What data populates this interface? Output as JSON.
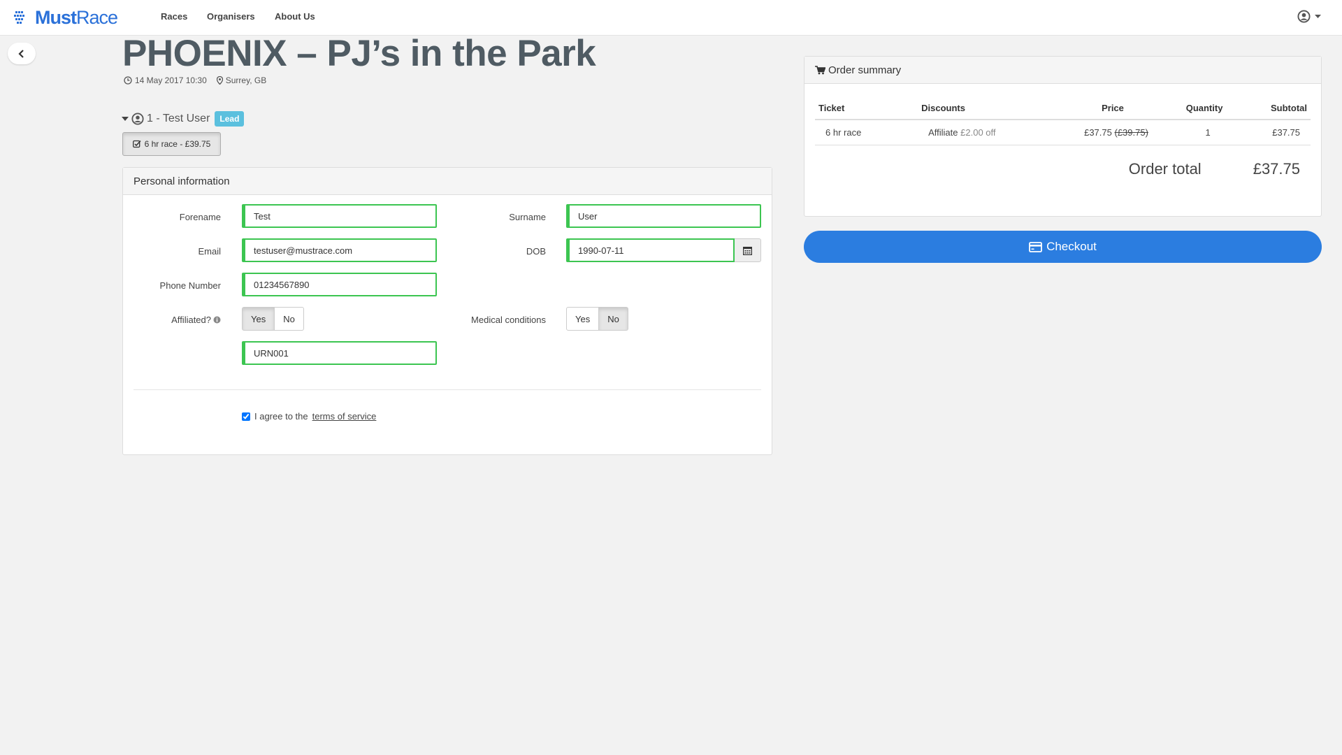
{
  "nav": {
    "logo_bold": "Must",
    "logo_light": "Race",
    "links": [
      "Races",
      "Organisers",
      "About Us"
    ]
  },
  "event": {
    "title": "PHOENIX – PJ’s in the Park",
    "datetime": "14 May 2017 10:30",
    "location": "Surrey, GB"
  },
  "entrant": {
    "label": "1 - Test User",
    "badge": "Lead",
    "ticket_button": "6 hr race - £39.75"
  },
  "personal": {
    "heading": "Personal information",
    "forename_label": "Forename",
    "forename_value": "Test",
    "surname_label": "Surname",
    "surname_value": "User",
    "email_label": "Email",
    "email_value": "testuser@mustrace.com",
    "dob_label": "DOB",
    "dob_value": "1990-07-11",
    "phone_label": "Phone Number",
    "phone_value": "01234567890",
    "affiliated_label": "Affiliated?",
    "affiliated_yes": "Yes",
    "affiliated_no": "No",
    "affiliated_selected": "Yes",
    "urn_value": "URN001",
    "medical_label": "Medical conditions",
    "medical_yes": "Yes",
    "medical_no": "No",
    "medical_selected": "No",
    "agree_text": "I agree to the",
    "terms_link": "terms of service"
  },
  "summary": {
    "heading": "Order summary",
    "columns": [
      "Ticket",
      "Discounts",
      "Price",
      "Quantity",
      "Subtotal"
    ],
    "row": {
      "ticket": "6 hr race",
      "discount_name": "Affiliate",
      "discount_amount": "£2.00 off",
      "price": "£37.75",
      "original_price": "(£39.75)",
      "quantity": "1",
      "subtotal": "£37.75"
    },
    "total_label": "Order total",
    "total_value": "£37.75"
  },
  "checkout_label": "Checkout",
  "colors": {
    "brand": "#2b71d9",
    "checkout": "#2b7de0",
    "valid_border": "#3cc551",
    "lead_badge": "#5bc0de",
    "title": "#4f5b63"
  }
}
